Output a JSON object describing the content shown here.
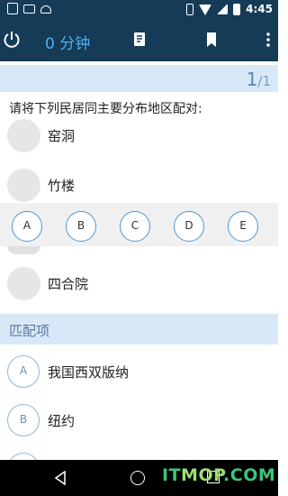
{
  "status_bar": {
    "time": "4:45",
    "icons": [
      "download-icon",
      "mail-icon",
      "android-icon",
      "vibrate-icon",
      "wifi-icon",
      "signal-icon",
      "battery-icon"
    ]
  },
  "app_bar": {
    "title": "0 分钟",
    "title_color": "#4fb0ef",
    "background": "#153b56",
    "icons": [
      "power-icon",
      "answer-card-icon",
      "bookmark-icon",
      "more-icon"
    ]
  },
  "page_indicator": {
    "current": "1",
    "separator": "/",
    "total": "1"
  },
  "question": {
    "text": "请将下列民居同主要分布地区配对:"
  },
  "premises": [
    {
      "label": "窑洞"
    },
    {
      "label": "竹楼"
    },
    {
      "label": "四合院"
    }
  ],
  "choices": [
    "A",
    "B",
    "C",
    "D",
    "E"
  ],
  "match_section": {
    "title": "匹配项",
    "items": [
      {
        "letter": "A",
        "label": "我国西双版纳"
      },
      {
        "letter": "B",
        "label": "纽约"
      }
    ]
  },
  "watermark": {
    "part1": "IT",
    "part2": "MOP",
    "part3": ".COM"
  },
  "colors": {
    "accent": "#4c97d4",
    "header_bg": "#d8e8f6",
    "watermark": "#3ac47a"
  }
}
